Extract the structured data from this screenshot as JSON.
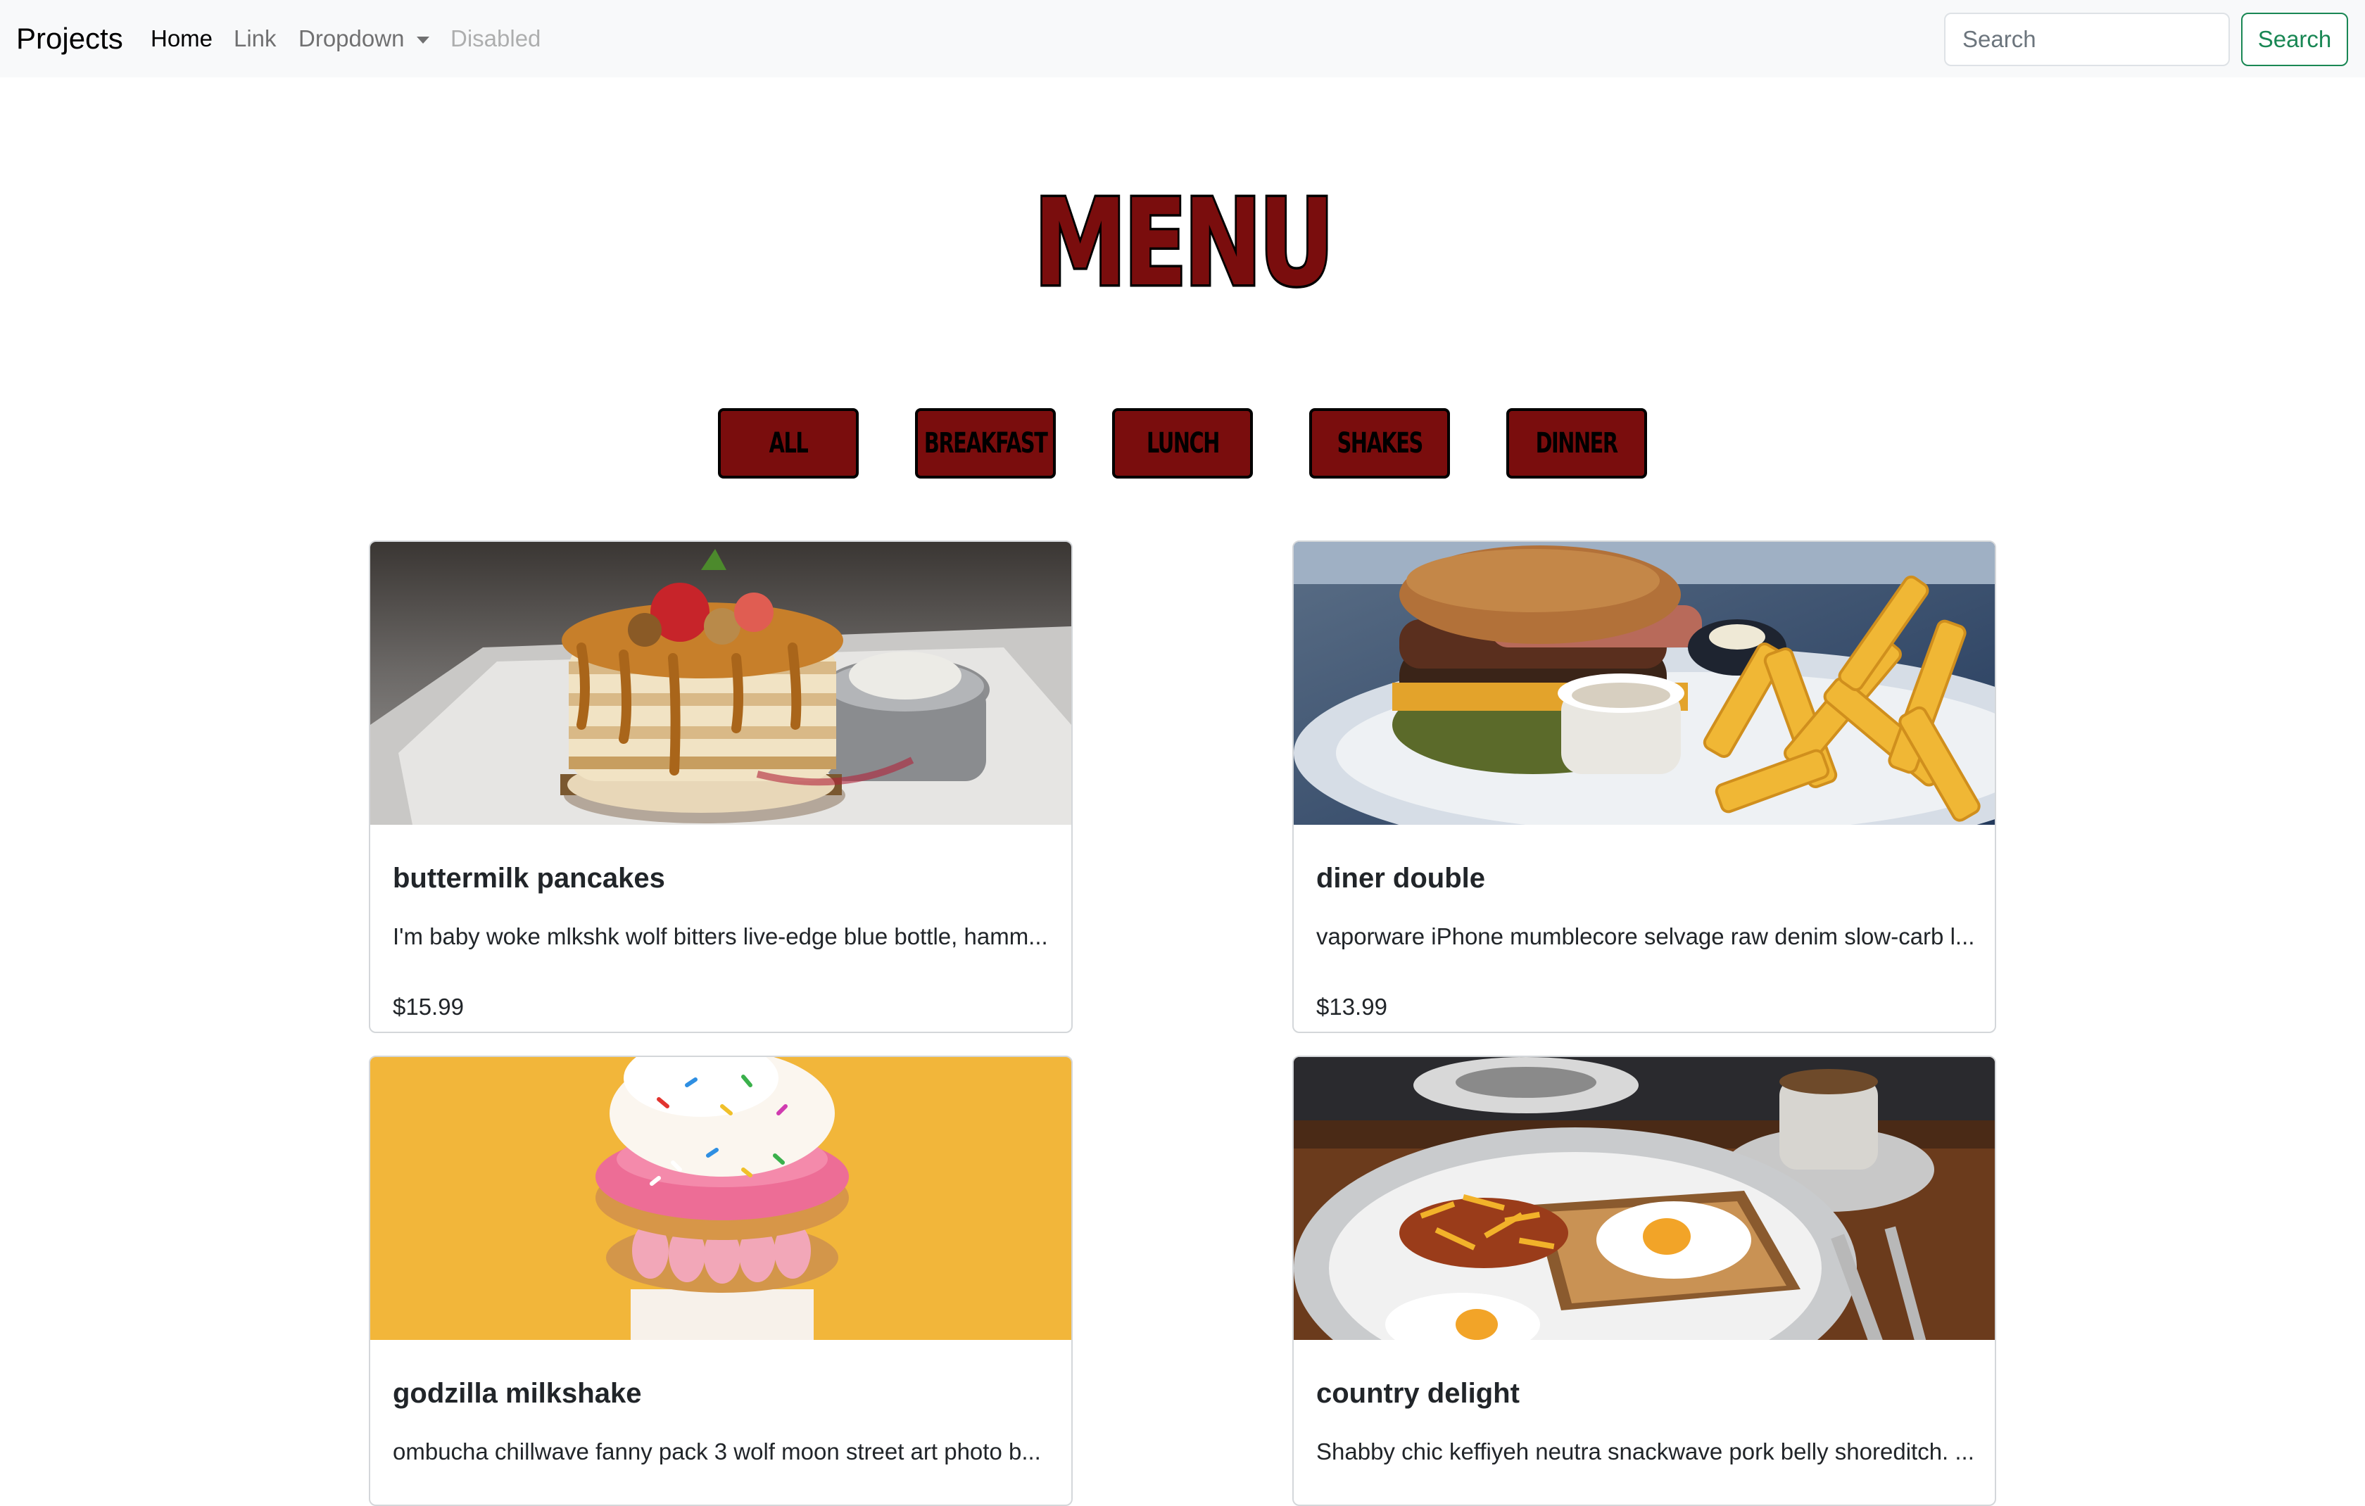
{
  "navbar": {
    "brand": "Projects",
    "links": [
      "Home",
      "Link",
      "Dropdown",
      "Disabled"
    ],
    "search": {
      "placeholder": "Search",
      "button_label": "Search"
    }
  },
  "page": {
    "title": "MENU"
  },
  "filters": [
    "ALL",
    "BREAKFAST",
    "LUNCH",
    "SHAKES",
    "DINNER"
  ],
  "items": [
    {
      "title": "buttermilk pancakes",
      "description": "I'm baby woke mlkshk wolf bitters live-edge blue bottle, hamm...",
      "price": "$15.99",
      "image": "pancakes-photo"
    },
    {
      "title": "diner double",
      "description": "vaporware iPhone mumblecore selvage raw denim slow-carb l...",
      "price": "$13.99",
      "image": "burger-photo"
    },
    {
      "title": "godzilla milkshake",
      "description": "ombucha chillwave fanny pack 3 wolf moon street art photo b...",
      "price": "",
      "image": "milkshake-photo"
    },
    {
      "title": "country delight",
      "description": "Shabby chic keffiyeh neutra snackwave pork belly shoreditch. ...",
      "price": "",
      "image": "breakfast-plate-photo"
    }
  ],
  "colors": {
    "navbar_bg": "#f8f9fa",
    "accent_red": "#7a0d0d",
    "search_green": "#198754",
    "milkshake_bg": "#f2b63a"
  }
}
